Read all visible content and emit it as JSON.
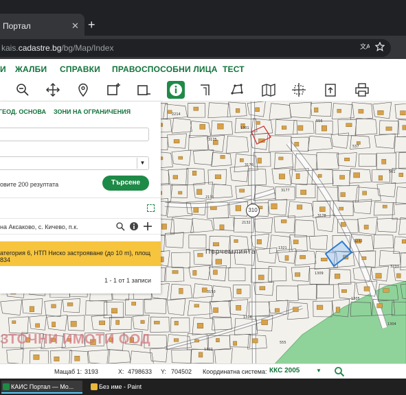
{
  "browser": {
    "tab_title": "Портал",
    "tab_close": "✕",
    "new_tab": "+",
    "url_prefix": "kais.",
    "url_domain": "cadastre.bg",
    "url_path": "/bg/Map/Index",
    "translate_icon": "translate-icon",
    "star_icon": "bookmark-star-icon"
  },
  "nav": {
    "items": [
      "И",
      "ЖАЛБИ",
      "СПРАВКИ",
      "ПРАВОСПОСОБНИ ЛИЦА",
      "ТЕСТ"
    ]
  },
  "toolbar": {
    "tools": [
      "zoom-out-icon",
      "pan-icon",
      "locate-pin-icon",
      "select-rect-icon",
      "deselect-rect-icon",
      "info-icon",
      "measure-icon",
      "draw-polygon-icon",
      "layers-map-icon",
      "coordinates-icon",
      "export-icon",
      "print-icon"
    ],
    "active_tool": "info-icon"
  },
  "panel": {
    "tabs": [
      "ГЕОД. ОСНОВА",
      "ЗОНИ НА ОГРАНИЧЕНИЯ"
    ],
    "field1_value": "",
    "select_value": "",
    "limit_text": "овите 200 резултата",
    "search_button": "Търсене",
    "result_text": "на Аксаково, с. Кичево, п.к.",
    "highlight_text": "атегория 6, НТП Ниско застрояване (до 10 m), площ 834",
    "pager_text": "1 - 1 от 1 записи"
  },
  "map": {
    "watermark": "ЗТОЧНИ ИМОТИ ООД",
    "place_label": "Перчемлията",
    "road_number": "310",
    "parcel_labels": [
      "2214",
      "3175",
      "3176",
      "3177",
      "3178",
      "3232",
      "3233",
      "3150",
      "1316",
      "555",
      "556",
      "537",
      "561",
      "2131",
      "2132",
      "1321",
      "1309",
      "1305",
      "1304",
      "1302",
      "1301"
    ]
  },
  "status": {
    "scale_label": "Мащаб 1:",
    "scale_value": "3193",
    "x_label": "X:",
    "x_value": "4798633",
    "y_label": "Y:",
    "y_value": "704502",
    "crs_label": "Координатна система:",
    "crs_value": "ККС 2005"
  },
  "taskbar": {
    "items": [
      "КАИС Портал — Mo...",
      "Без име - Paint"
    ]
  },
  "colors": {
    "brand_green": "#1e8a47",
    "nav_green": "#12733b",
    "highlight": "#f6c43d",
    "building": "#d8a24a",
    "forest": "#8fd39a"
  }
}
